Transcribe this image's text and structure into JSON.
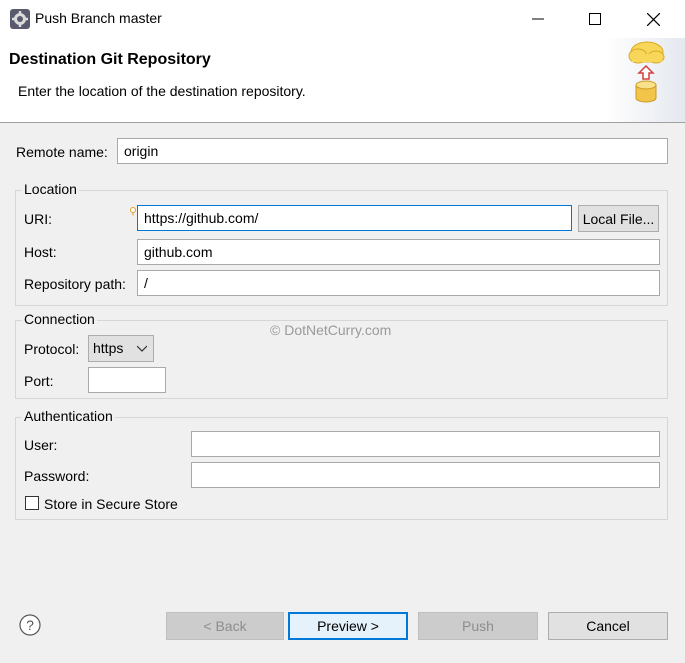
{
  "window": {
    "title": "Push Branch master"
  },
  "header": {
    "title": "Destination Git Repository",
    "description": "Enter the location of the destination repository."
  },
  "form": {
    "remote_name_label": "Remote name:",
    "remote_name_value": "origin",
    "location": {
      "group_title": "Location",
      "uri_label": "URI:",
      "uri_value": "https://github.com/",
      "local_file_button": "Local File...",
      "host_label": "Host:",
      "host_value": "github.com",
      "repo_path_label": "Repository path:",
      "repo_path_value": "/"
    },
    "connection": {
      "group_title": "Connection",
      "protocol_label": "Protocol:",
      "protocol_value": "https",
      "port_label": "Port:",
      "port_value": ""
    },
    "authentication": {
      "group_title": "Authentication",
      "user_label": "User:",
      "user_value": "",
      "password_label": "Password:",
      "password_value": "",
      "store_label": "Store in Secure Store",
      "store_checked": false
    }
  },
  "watermark": "© DotNetCurry.com",
  "footer": {
    "back_button": "< Back",
    "preview_button": "Preview >",
    "push_button": "Push",
    "cancel_button": "Cancel"
  },
  "icons": {
    "app": "eclipse-gear-icon",
    "minimize": "minimize-icon",
    "maximize": "maximize-icon",
    "close": "close-icon",
    "banner": "cloud-upload-database-icon",
    "help": "help-icon",
    "content_assist": "lightbulb-icon"
  },
  "colors": {
    "focus_border": "#0078d7",
    "dialog_bg": "#f0f0f0"
  }
}
